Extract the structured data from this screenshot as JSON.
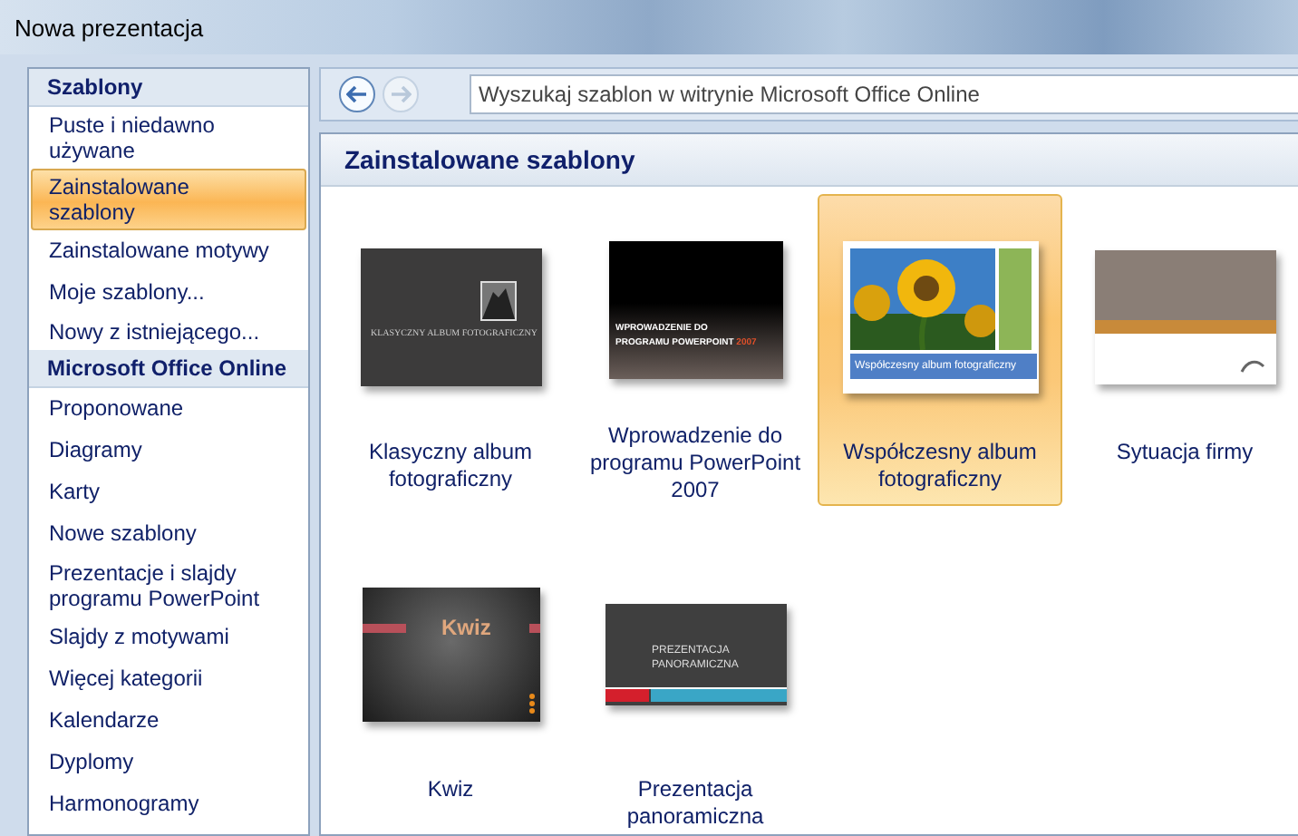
{
  "window": {
    "title": "Nowa prezentacja"
  },
  "sidebar": {
    "sections": [
      {
        "title": "Szablony",
        "items": [
          {
            "label": "Puste i niedawno używane",
            "selected": false
          },
          {
            "label": "Zainstalowane szablony",
            "selected": true
          },
          {
            "label": "Zainstalowane motywy",
            "selected": false
          },
          {
            "label": "Moje szablony...",
            "selected": false
          },
          {
            "label": "Nowy z istniejącego...",
            "selected": false
          }
        ]
      },
      {
        "title": "Microsoft Office Online",
        "items": [
          {
            "label": "Proponowane",
            "selected": false
          },
          {
            "label": "Diagramy",
            "selected": false
          },
          {
            "label": "Karty",
            "selected": false
          },
          {
            "label": "Nowe szablony",
            "selected": false
          },
          {
            "label": "Prezentacje i slajdy programu PowerPoint",
            "selected": false
          },
          {
            "label": "Slajdy z motywami",
            "selected": false
          },
          {
            "label": "Więcej kategorii",
            "selected": false
          },
          {
            "label": "Kalendarze",
            "selected": false
          },
          {
            "label": "Dyplomy",
            "selected": false
          },
          {
            "label": "Harmonogramy",
            "selected": false
          }
        ]
      }
    ]
  },
  "toolbar": {
    "back_disabled": false,
    "forward_disabled": true,
    "search": {
      "placeholder": "Wyszukaj szablon w witrynie Microsoft Office Online"
    }
  },
  "gallery": {
    "title": "Zainstalowane szablony",
    "templates": [
      {
        "label": "Klasyczny album fotograficzny",
        "kind": "classic",
        "slide_title": "KLASYCZNY ALBUM FOTOGRAFICZNY",
        "selected": false
      },
      {
        "label": "Wprowadzenie do programu PowerPoint 2007",
        "kind": "intro",
        "slide_title": "WPROWADZENIE DO PROGRAMU POWERPOINT",
        "slide_accent": "2007",
        "selected": false
      },
      {
        "label": "Współczesny album fotograficzny",
        "kind": "modern",
        "slide_title": "Współczesny album fotograficzny",
        "selected": true
      },
      {
        "label": "Sytuacja firmy",
        "kind": "business",
        "selected": false
      },
      {
        "label": "Kwiz",
        "kind": "quiz",
        "slide_title": "Kwiz",
        "selected": false
      },
      {
        "label": "Prezentacja panoramiczna",
        "kind": "panoramic",
        "slide_title": "PREZENTACJA PANORAMICZNA",
        "selected": false
      }
    ]
  }
}
